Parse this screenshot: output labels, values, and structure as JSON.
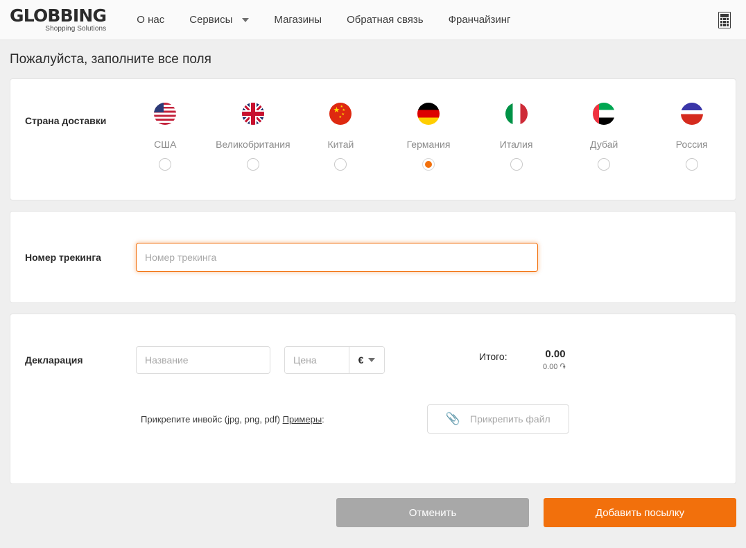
{
  "header": {
    "logo_main": "GLOBBING",
    "logo_sub": "Shopping Solutions",
    "nav": [
      {
        "label": "О нас",
        "caret": false
      },
      {
        "label": "Сервисы",
        "caret": true
      },
      {
        "label": "Магазины",
        "caret": false
      },
      {
        "label": "Обратная связь",
        "caret": false
      },
      {
        "label": "Франчайзинг",
        "caret": false
      }
    ],
    "calculator_icon": "calculator-icon"
  },
  "page": {
    "title": "Пожалуйста, заполните все поля"
  },
  "country_section": {
    "label": "Страна доставки",
    "selected": "Германия",
    "countries": [
      {
        "name": "США",
        "code": "us",
        "selected": false
      },
      {
        "name": "Великобритания",
        "code": "uk",
        "selected": false
      },
      {
        "name": "Китай",
        "code": "cn",
        "selected": false
      },
      {
        "name": "Германия",
        "code": "de",
        "selected": true
      },
      {
        "name": "Италия",
        "code": "it",
        "selected": false
      },
      {
        "name": "Дубай",
        "code": "ae",
        "selected": false
      },
      {
        "name": "Россия",
        "code": "ru",
        "selected": false
      }
    ]
  },
  "tracking_section": {
    "label": "Номер трекинга",
    "placeholder": "Номер трекинга",
    "value": "",
    "focused": true
  },
  "declaration_section": {
    "label": "Декларация",
    "name_placeholder": "Название",
    "name_value": "",
    "price_placeholder": "Цена",
    "price_value": "",
    "currency_symbol": "€",
    "total_label": "Итого:",
    "total_main": "0.00",
    "total_sub": "0.00 ֏",
    "invoice_text": "Прикрепите инвойс (jpg, png, pdf)",
    "invoice_link": "Примеры",
    "invoice_colon": ":",
    "attach_label": "Прикрепить файл",
    "attach_icon": "paperclip-icon"
  },
  "actions": {
    "cancel_label": "Отменить",
    "submit_label": "Добавить посылку"
  },
  "colors": {
    "accent": "#f2700c",
    "page_background": "#efefef",
    "card_background": "#ffffff",
    "cancel_button": "#a8a8a8",
    "muted_text": "#8b8b8b"
  }
}
